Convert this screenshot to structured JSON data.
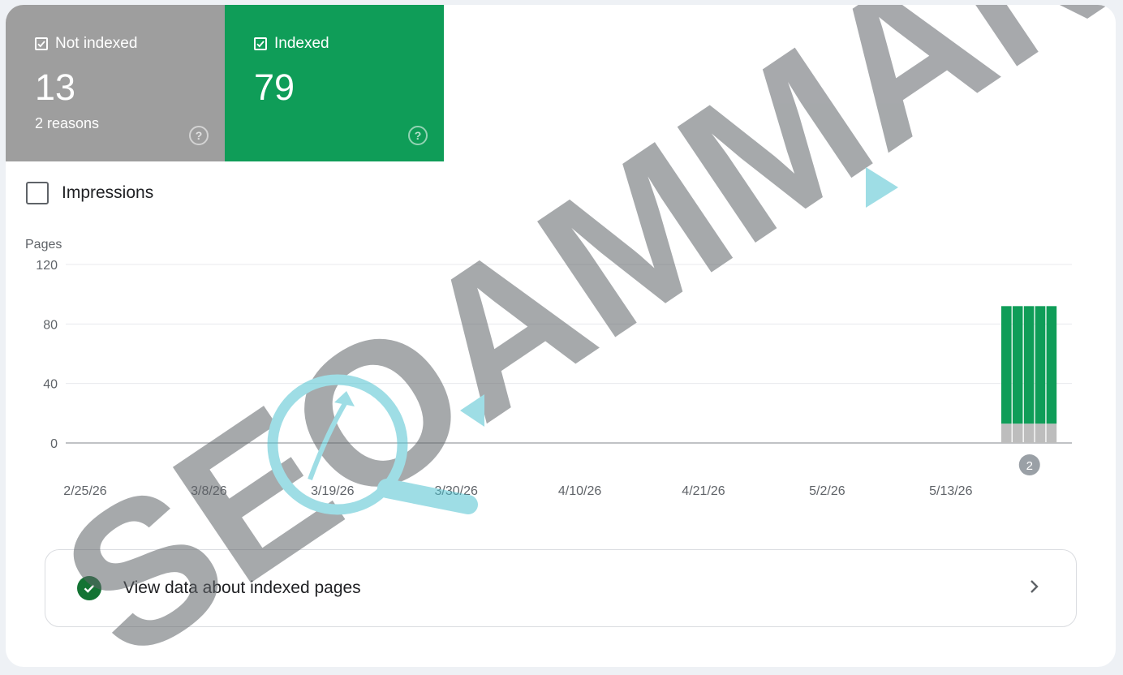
{
  "tiles": {
    "not_indexed": {
      "label": "Not indexed",
      "value": "13",
      "sub": "2 reasons",
      "help": "?",
      "color": "#9e9e9e",
      "checked": true
    },
    "indexed": {
      "label": "Indexed",
      "value": "79",
      "help": "?",
      "color": "#0f9d58",
      "checked": true
    }
  },
  "impressions": {
    "label": "Impressions",
    "checked": false
  },
  "chart_data": {
    "type": "bar",
    "ylabel": "Pages",
    "ylim": [
      0,
      120
    ],
    "yticks": [
      0,
      40,
      80,
      120
    ],
    "xtick_labels": [
      "2/25/26",
      "3/8/26",
      "3/19/26",
      "3/30/26",
      "4/10/26",
      "4/21/26",
      "5/2/26",
      "5/13/26"
    ],
    "stacked": true,
    "categories": [
      "5/20/26",
      "5/21/26",
      "5/22/26",
      "5/23/26",
      "5/24/26"
    ],
    "series": [
      {
        "name": "Not indexed",
        "color": "#bdbdbd",
        "values": [
          13,
          13,
          13,
          13,
          13
        ]
      },
      {
        "name": "Indexed",
        "color": "#0f9d58",
        "values": [
          79,
          79,
          79,
          79,
          79
        ]
      }
    ],
    "annotations": [
      {
        "label": "2"
      }
    ],
    "grid": true
  },
  "link": {
    "label": "View data about indexed pages",
    "icon": "check-circle-icon",
    "chevron": "chevron-right-icon"
  },
  "watermark": {
    "text": "SEOAMMAN",
    "icons": [
      "magnifier-growth-icon"
    ]
  }
}
